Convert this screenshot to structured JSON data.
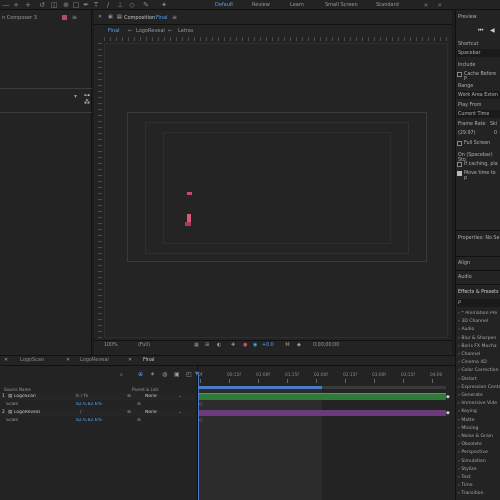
{
  "toolbar": {
    "workspaces": [
      "Default",
      "Review",
      "Learn",
      "Small Screen",
      "Standard"
    ],
    "active_workspace": "Default",
    "left_panel_title": "n Composer 3"
  },
  "composition": {
    "panel_title": "Composition",
    "comp_name": "Final",
    "tabs": [
      "Final",
      "LogoReveal",
      "Letras"
    ],
    "zoom": "100%",
    "resolution": "(Full)",
    "exposure": "+0.0",
    "timecode": "0;00;00;00"
  },
  "preview": {
    "title": "Preview",
    "shortcut_label": "Shortcut",
    "shortcut_value": "Spacebar",
    "include_label": "Include",
    "cache_label": "Cache Before P",
    "range_label": "Range",
    "range_value": "Work Area Exten",
    "play_from_label": "Play From",
    "play_from_value": "Current Time",
    "frame_rate_label": "Frame Rate",
    "skip_label": "Ski",
    "frame_rate_value": "(29.97)",
    "skip_value": "0",
    "full_screen_label": "Full Screen",
    "on_stop_label": "On (Spacebar) Sto",
    "if_caching_label": "If caching, pla",
    "move_time_label": "Move time to p"
  },
  "properties": {
    "title": "Properties: No Se"
  },
  "align": {
    "title": "Align"
  },
  "audio": {
    "title": "Audio"
  },
  "effects": {
    "title": "Effects & Presets",
    "search_placeholder": "ρ",
    "items": [
      "* Animation Pre",
      "3D Channel",
      "Audio",
      "Blur & Sharpen",
      "Boris FX Mocha",
      "Channel",
      "Cinema 4D",
      "Color Correction",
      "Distort",
      "Expression Contr",
      "Generate",
      "Immersive Vide",
      "Keying",
      "Matte",
      "Missing",
      "Noise & Grain",
      "Obsolete",
      "Perspective",
      "Simulation",
      "Stylize",
      "Text",
      "Time",
      "Transition"
    ]
  },
  "timeline": {
    "tabs": [
      "LogoScan",
      "LogoReveal",
      "Final"
    ],
    "active_tab": "Final",
    "col_source": "Source Name",
    "col_parent": "Parent & Link",
    "layers": [
      {
        "num": "1",
        "name": "LogoScan",
        "parent": "None",
        "prop": "Scale",
        "value": "82.6,82.6%"
      },
      {
        "num": "2",
        "name": "LogoReveal",
        "parent": "None",
        "prop": "Scale",
        "value": "82.6,82.6%"
      }
    ],
    "ruler": [
      "0f",
      "00:15f",
      "01:00f",
      "01:15f",
      "02:00f",
      "02:15f",
      "03:00f",
      "03:15f",
      "04:00"
    ],
    "track_colors": [
      "#2f7a3a",
      "#6a3a7a"
    ]
  }
}
